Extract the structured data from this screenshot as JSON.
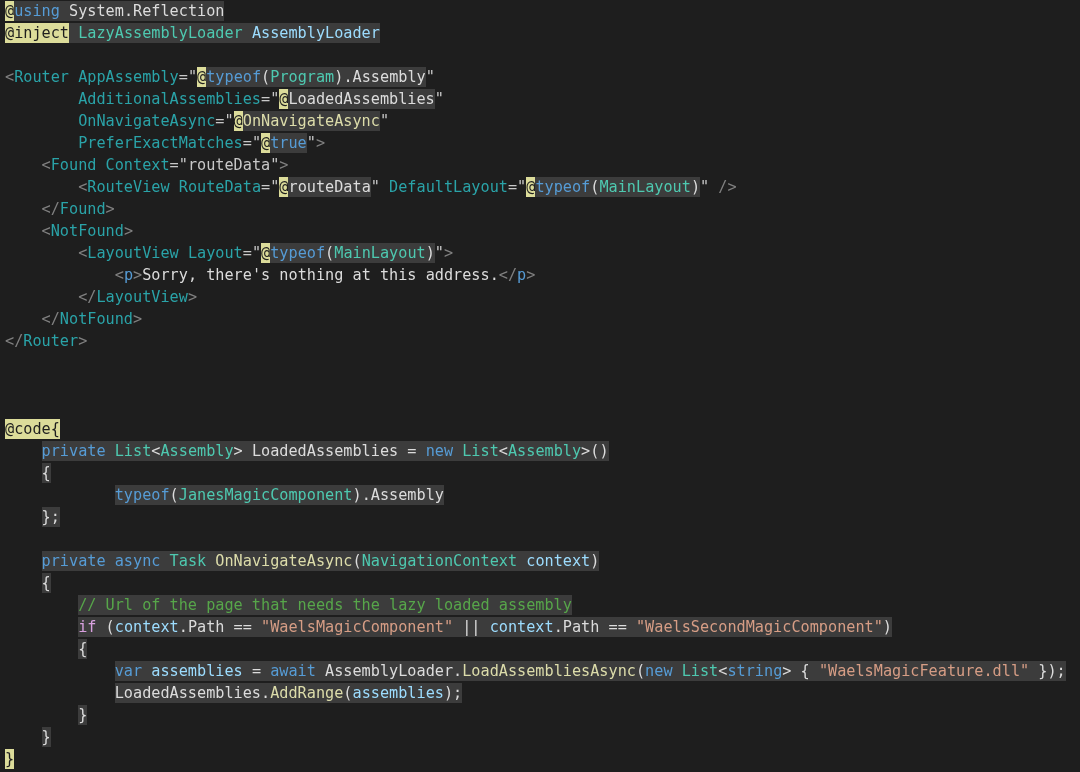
{
  "editor": {
    "lines": [
      {
        "kind": "code",
        "tokens": [
          {
            "text": "@",
            "kind": "at",
            "shaded": false
          },
          {
            "text": "using",
            "kind": "kw",
            "shaded": true
          },
          {
            "text": " System.Reflection",
            "kind": "plain",
            "shaded": true
          }
        ]
      },
      {
        "kind": "code",
        "tokens": [
          {
            "text": "@inject",
            "kind": "at",
            "shaded": false
          },
          {
            "text": " LazyAssemblyLoader",
            "kind": "type",
            "shaded": true
          },
          {
            "text": " AssemblyLoader",
            "kind": "ident",
            "shaded": true
          }
        ]
      },
      {
        "kind": "blank"
      },
      {
        "kind": "code",
        "tokens": [
          {
            "text": "<",
            "kind": "delim",
            "shaded": false
          },
          {
            "text": "Router",
            "kind": "tag",
            "shaded": false
          },
          {
            "text": " AppAssembly",
            "kind": "tag",
            "shaded": false
          },
          {
            "text": "=\"",
            "kind": "quote",
            "shaded": false
          },
          {
            "text": "@",
            "kind": "at",
            "shaded": false
          },
          {
            "text": "typeof",
            "kind": "kw",
            "shaded": true
          },
          {
            "text": "(",
            "kind": "plain",
            "shaded": true
          },
          {
            "text": "Program",
            "kind": "type",
            "shaded": true
          },
          {
            "text": ").Assembly",
            "kind": "plain",
            "shaded": true
          },
          {
            "text": "\"",
            "kind": "quote",
            "shaded": false
          }
        ],
        "children": [
          {
            "kind": "continuation",
            "tokens": [
              {
                "text": "AdditionalAssemblies",
                "kind": "tag",
                "shaded": false
              },
              {
                "text": "=\"",
                "kind": "quote",
                "shaded": false
              },
              {
                "text": "@",
                "kind": "at",
                "shaded": false
              },
              {
                "text": "LoadedAssemblies",
                "kind": "plain",
                "shaded": true
              },
              {
                "text": "\"",
                "kind": "quote",
                "shaded": false
              }
            ]
          },
          {
            "kind": "continuation",
            "tokens": [
              {
                "text": "OnNavigateAsync",
                "kind": "tag",
                "shaded": false
              },
              {
                "text": "=\"",
                "kind": "quote",
                "shaded": false
              },
              {
                "text": "@",
                "kind": "at",
                "shaded": false
              },
              {
                "text": "OnNavigateAsync",
                "kind": "method",
                "shaded": true
              },
              {
                "text": "\"",
                "kind": "quote",
                "shaded": false
              }
            ]
          },
          {
            "kind": "continuation",
            "tokens": [
              {
                "text": "PreferExactMatches",
                "kind": "tag",
                "shaded": false
              },
              {
                "text": "=\"",
                "kind": "quote",
                "shaded": false
              },
              {
                "text": "@",
                "kind": "at",
                "shaded": false
              },
              {
                "text": "true",
                "kind": "kw",
                "shaded": true
              },
              {
                "text": "\"",
                "kind": "quote",
                "shaded": false
              },
              {
                "text": ">",
                "kind": "delim",
                "shaded": false
              }
            ]
          },
          {
            "kind": "code",
            "tokens": [
              {
                "text": "<",
                "kind": "delim",
                "shaded": false
              },
              {
                "text": "Found",
                "kind": "tag",
                "shaded": false
              },
              {
                "text": " Context",
                "kind": "tag",
                "shaded": false
              },
              {
                "text": "=\"routeData\"",
                "kind": "quote",
                "shaded": false
              },
              {
                "text": ">",
                "kind": "delim",
                "shaded": false
              }
            ],
            "children": [
              {
                "kind": "code",
                "tokens": [
                  {
                    "text": "<",
                    "kind": "delim",
                    "shaded": false
                  },
                  {
                    "text": "RouteView",
                    "kind": "tag",
                    "shaded": false
                  },
                  {
                    "text": " RouteData",
                    "kind": "tag",
                    "shaded": false
                  },
                  {
                    "text": "=\"",
                    "kind": "quote",
                    "shaded": false
                  },
                  {
                    "text": "@",
                    "kind": "at",
                    "shaded": false
                  },
                  {
                    "text": "routeData",
                    "kind": "plain",
                    "shaded": true
                  },
                  {
                    "text": "\"",
                    "kind": "quote",
                    "shaded": false
                  },
                  {
                    "text": " DefaultLayout",
                    "kind": "tag",
                    "shaded": false
                  },
                  {
                    "text": "=\"",
                    "kind": "quote",
                    "shaded": false
                  },
                  {
                    "text": "@",
                    "kind": "at",
                    "shaded": false
                  },
                  {
                    "text": "typeof",
                    "kind": "kw",
                    "shaded": true
                  },
                  {
                    "text": "(",
                    "kind": "plain",
                    "shaded": true
                  },
                  {
                    "text": "MainLayout",
                    "kind": "type",
                    "shaded": true
                  },
                  {
                    "text": ")",
                    "kind": "plain",
                    "shaded": true
                  },
                  {
                    "text": "\"",
                    "kind": "quote",
                    "shaded": false
                  },
                  {
                    "text": " />",
                    "kind": "delim",
                    "shaded": false
                  }
                ]
              }
            ]
          },
          {
            "kind": "code",
            "tokens": [
              {
                "text": "</",
                "kind": "delim",
                "shaded": false
              },
              {
                "text": "Found",
                "kind": "tag",
                "shaded": false
              },
              {
                "text": ">",
                "kind": "delim",
                "shaded": false
              }
            ]
          },
          {
            "kind": "code",
            "tokens": [
              {
                "text": "<",
                "kind": "delim",
                "shaded": false
              },
              {
                "text": "NotFound",
                "kind": "tag",
                "shaded": false
              },
              {
                "text": ">",
                "kind": "delim",
                "shaded": false
              }
            ],
            "children": [
              {
                "kind": "code",
                "tokens": [
                  {
                    "text": "<",
                    "kind": "delim",
                    "shaded": false
                  },
                  {
                    "text": "LayoutView",
                    "kind": "tag",
                    "shaded": false
                  },
                  {
                    "text": " Layout",
                    "kind": "tag",
                    "shaded": false
                  },
                  {
                    "text": "=\"",
                    "kind": "quote",
                    "shaded": false
                  },
                  {
                    "text": "@",
                    "kind": "at",
                    "shaded": false
                  },
                  {
                    "text": "typeof",
                    "kind": "kw",
                    "shaded": true
                  },
                  {
                    "text": "(",
                    "kind": "plain",
                    "shaded": true
                  },
                  {
                    "text": "MainLayout",
                    "kind": "type",
                    "shaded": true
                  },
                  {
                    "text": ")",
                    "kind": "plain",
                    "shaded": true
                  },
                  {
                    "text": "\"",
                    "kind": "quote",
                    "shaded": false
                  },
                  {
                    "text": ">",
                    "kind": "delim",
                    "shaded": false
                  }
                ],
                "children": [
                  {
                    "kind": "code",
                    "tokens": [
                      {
                        "text": "<",
                        "kind": "delim",
                        "shaded": false
                      },
                      {
                        "text": "p",
                        "kind": "html",
                        "shaded": false
                      },
                      {
                        "text": ">",
                        "kind": "delim",
                        "shaded": false
                      },
                      {
                        "text": "Sorry, there's nothing at this address.",
                        "kind": "plain",
                        "shaded": false
                      },
                      {
                        "text": "</",
                        "kind": "delim",
                        "shaded": false
                      },
                      {
                        "text": "p",
                        "kind": "html",
                        "shaded": false
                      },
                      {
                        "text": ">",
                        "kind": "delim",
                        "shaded": false
                      }
                    ]
                  }
                ]
              },
              {
                "kind": "code",
                "tokens": [
                  {
                    "text": "</",
                    "kind": "delim",
                    "shaded": false
                  },
                  {
                    "text": "LayoutView",
                    "kind": "tag",
                    "shaded": false
                  },
                  {
                    "text": ">",
                    "kind": "delim",
                    "shaded": false
                  }
                ]
              }
            ]
          },
          {
            "kind": "code",
            "tokens": [
              {
                "text": "</",
                "kind": "delim",
                "shaded": false
              },
              {
                "text": "NotFound",
                "kind": "tag",
                "shaded": false
              },
              {
                "text": ">",
                "kind": "delim",
                "shaded": false
              }
            ]
          }
        ]
      },
      {
        "kind": "code",
        "tokens": [
          {
            "text": "</",
            "kind": "delim",
            "shaded": false
          },
          {
            "text": "Router",
            "kind": "tag",
            "shaded": false
          },
          {
            "text": ">",
            "kind": "delim",
            "shaded": false
          }
        ]
      },
      {
        "kind": "blank"
      },
      {
        "kind": "blank"
      },
      {
        "kind": "blank"
      },
      {
        "kind": "code",
        "tokens": [
          {
            "text": "@code{",
            "kind": "at",
            "shaded": false
          }
        ],
        "children": [
          {
            "kind": "code",
            "tokens": [
              {
                "text": "private",
                "kind": "kw",
                "shaded": true
              },
              {
                "text": " List",
                "kind": "type",
                "shaded": true
              },
              {
                "text": "<",
                "kind": "plain",
                "shaded": true
              },
              {
                "text": "Assembly",
                "kind": "type",
                "shaded": true
              },
              {
                "text": "> LoadedAssemblies = ",
                "kind": "plain",
                "shaded": true
              },
              {
                "text": "new",
                "kind": "kw",
                "shaded": true
              },
              {
                "text": " List",
                "kind": "type",
                "shaded": true
              },
              {
                "text": "<",
                "kind": "plain",
                "shaded": true
              },
              {
                "text": "Assembly",
                "kind": "type",
                "shaded": true
              },
              {
                "text": ">()",
                "kind": "plain",
                "shaded": true
              }
            ]
          },
          {
            "kind": "code",
            "tokens": [
              {
                "text": "{",
                "kind": "plain",
                "shaded": true
              }
            ],
            "children": [
              {
                "kind": "continuation",
                "tokens": [
                  {
                    "text": "typeof",
                    "kind": "kw",
                    "shaded": true
                  },
                  {
                    "text": "(",
                    "kind": "plain",
                    "shaded": true
                  },
                  {
                    "text": "JanesMagicComponent",
                    "kind": "type",
                    "shaded": true
                  },
                  {
                    "text": ").Assembly",
                    "kind": "plain",
                    "shaded": true
                  }
                ]
              }
            ]
          },
          {
            "kind": "code",
            "tokens": [
              {
                "text": "};",
                "kind": "plain",
                "shaded": true
              }
            ]
          },
          {
            "kind": "blank"
          },
          {
            "kind": "code",
            "tokens": [
              {
                "text": "private",
                "kind": "kw",
                "shaded": true
              },
              {
                "text": " async",
                "kind": "kw",
                "shaded": true
              },
              {
                "text": " Task",
                "kind": "type",
                "shaded": true
              },
              {
                "text": " OnNavigateAsync",
                "kind": "method",
                "shaded": true
              },
              {
                "text": "(",
                "kind": "plain",
                "shaded": true
              },
              {
                "text": "NavigationContext",
                "kind": "type",
                "shaded": true
              },
              {
                "text": " context",
                "kind": "ident",
                "shaded": true
              },
              {
                "text": ")",
                "kind": "plain",
                "shaded": true
              }
            ]
          },
          {
            "kind": "code",
            "tokens": [
              {
                "text": "{",
                "kind": "plain",
                "shaded": true
              }
            ],
            "children": [
              {
                "kind": "code",
                "tokens": [
                  {
                    "text": "// Url of the page that needs the lazy loaded assembly",
                    "kind": "comment",
                    "shaded": true
                  }
                ]
              },
              {
                "kind": "code",
                "tokens": [
                  {
                    "text": "if",
                    "kind": "ctl",
                    "shaded": true
                  },
                  {
                    "text": " (",
                    "kind": "plain",
                    "shaded": true
                  },
                  {
                    "text": "context",
                    "kind": "ident",
                    "shaded": true
                  },
                  {
                    "text": ".Path == ",
                    "kind": "plain",
                    "shaded": true
                  },
                  {
                    "text": "\"WaelsMagicComponent\"",
                    "kind": "str",
                    "shaded": true
                  },
                  {
                    "text": " || ",
                    "kind": "plain",
                    "shaded": true
                  },
                  {
                    "text": "context",
                    "kind": "ident",
                    "shaded": true
                  },
                  {
                    "text": ".Path == ",
                    "kind": "plain",
                    "shaded": true
                  },
                  {
                    "text": "\"WaelsSecondMagicComponent\"",
                    "kind": "str",
                    "shaded": true
                  },
                  {
                    "text": ")",
                    "kind": "plain",
                    "shaded": true
                  }
                ]
              },
              {
                "kind": "code",
                "tokens": [
                  {
                    "text": "{",
                    "kind": "plain",
                    "shaded": true
                  }
                ],
                "children": [
                  {
                    "kind": "code",
                    "tokens": [
                      {
                        "text": "var",
                        "kind": "kw",
                        "shaded": true
                      },
                      {
                        "text": " assemblies",
                        "kind": "ident",
                        "shaded": true
                      },
                      {
                        "text": " = ",
                        "kind": "plain",
                        "shaded": true
                      },
                      {
                        "text": "await",
                        "kind": "kw",
                        "shaded": true
                      },
                      {
                        "text": " AssemblyLoader.",
                        "kind": "plain",
                        "shaded": true
                      },
                      {
                        "text": "LoadAssembliesAsync",
                        "kind": "method",
                        "shaded": true
                      },
                      {
                        "text": "(",
                        "kind": "plain",
                        "shaded": true
                      },
                      {
                        "text": "new",
                        "kind": "kw",
                        "shaded": true
                      },
                      {
                        "text": " List",
                        "kind": "type",
                        "shaded": true
                      },
                      {
                        "text": "<",
                        "kind": "plain",
                        "shaded": true
                      },
                      {
                        "text": "string",
                        "kind": "kw",
                        "shaded": true
                      },
                      {
                        "text": "> { ",
                        "kind": "plain",
                        "shaded": true
                      },
                      {
                        "text": "\"WaelsMagicFeature.dll\"",
                        "kind": "str",
                        "shaded": true
                      },
                      {
                        "text": " });",
                        "kind": "plain",
                        "shaded": true
                      }
                    ]
                  },
                  {
                    "kind": "code",
                    "tokens": [
                      {
                        "text": "LoadedAssemblies.",
                        "kind": "plain",
                        "shaded": true
                      },
                      {
                        "text": "AddRange",
                        "kind": "method",
                        "shaded": true
                      },
                      {
                        "text": "(",
                        "kind": "plain",
                        "shaded": true
                      },
                      {
                        "text": "assemblies",
                        "kind": "ident",
                        "shaded": true
                      },
                      {
                        "text": ");",
                        "kind": "plain",
                        "shaded": true
                      }
                    ]
                  }
                ]
              },
              {
                "kind": "code",
                "tokens": [
                  {
                    "text": "}",
                    "kind": "plain",
                    "shaded": true
                  }
                ]
              }
            ]
          },
          {
            "kind": "code",
            "tokens": [
              {
                "text": "}",
                "kind": "plain",
                "shaded": true
              }
            ]
          }
        ]
      },
      {
        "kind": "code",
        "tokens": [
          {
            "text": "}",
            "kind": "at",
            "shaded": false
          }
        ]
      }
    ]
  }
}
